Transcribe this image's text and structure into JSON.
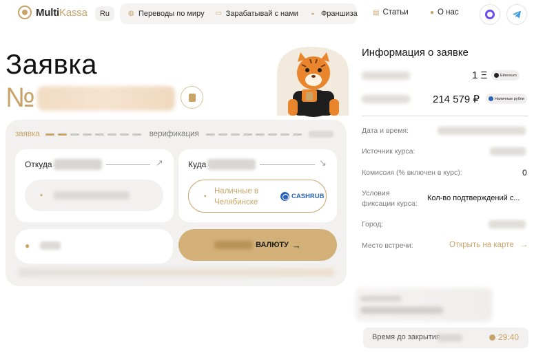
{
  "header": {
    "logo_prefix": "Multi",
    "logo_suffix": "Kassa",
    "lang": "Ru",
    "nav": [
      {
        "label": "Переводы по миру",
        "icon": "globe-icon"
      },
      {
        "label": "Зарабатывай с нами",
        "icon": "wallet-icon"
      },
      {
        "label": "Франшиза",
        "icon": "handshake-icon"
      }
    ],
    "articles": "Статьи",
    "about": "О нас"
  },
  "request": {
    "title": "Заявка",
    "number_prefix": "№"
  },
  "steps": {
    "step1": "заявка",
    "step2": "верификация"
  },
  "exchange": {
    "from_label": "Откуда",
    "to_label": "Куда",
    "to_name": "Наличные в Челябинске",
    "to_provider": "CASHRUB",
    "submit_suffix": "ВАЛЮТУ",
    "submit_arrow": "→"
  },
  "info": {
    "title": "Информация о заявке",
    "amount_in": "1 Ξ",
    "amount_in_badge": "Ethereum",
    "amount_out": "214 579 ₽",
    "amount_out_badge": "Наличные рубли",
    "rows": {
      "datetime": "Дата и время:",
      "rate_source": "Источник курса:",
      "commission": "Комиссия (% включен в курс):",
      "commission_value": "0",
      "fixation": "Условия фиксации курса:",
      "fixation_value": "Кол-во подтверждений с...",
      "city": "Город:",
      "meeting": "Место встречи:",
      "map_link": "Открыть на карте"
    },
    "timer_label": "Время до закрытия",
    "timer_value": "29:40"
  },
  "colors": {
    "accent": "#c9a469",
    "panel_bg": "#f2f1ef",
    "cashrub_blue": "#2b63b8",
    "ethereum_dot": "#222222",
    "ruble_dot": "#2b63b8"
  }
}
